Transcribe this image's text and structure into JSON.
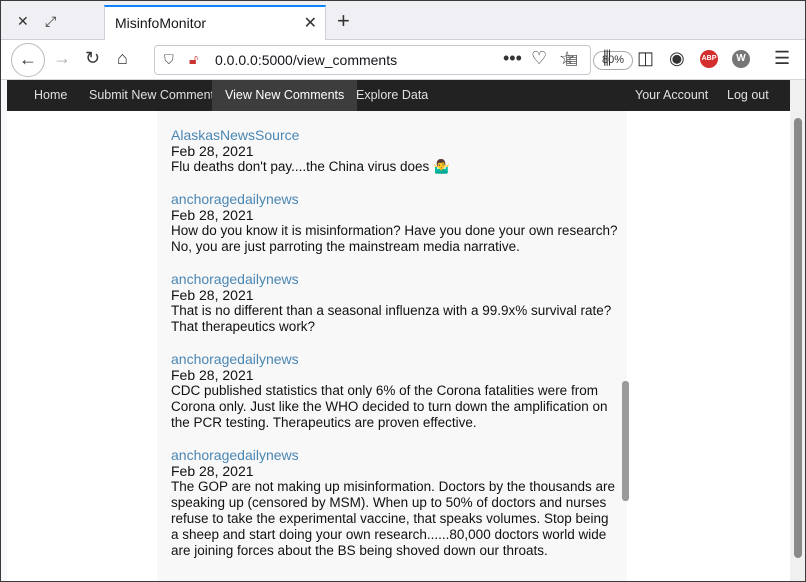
{
  "browser": {
    "tab_title": "MisinfoMonitor",
    "url": "0.0.0.0:5000/view_comments",
    "zoom": "80%",
    "abp_label": "ABP",
    "w_label": "W"
  },
  "nav": {
    "items": [
      "Home",
      "Submit New Comment",
      "View New Comments",
      "Explore Data"
    ],
    "right_items": [
      "Your Account",
      "Log out"
    ],
    "active": "View New Comments"
  },
  "comments": [
    {
      "author": "AlaskasNewsSource",
      "date": "Feb 28, 2021",
      "text": "Flu deaths don't pay....the China virus does 🤷‍♂️"
    },
    {
      "author": "anchoragedailynews",
      "date": "Feb 28, 2021",
      "text": "How do you know it is misinformation? Have you done your own research? No, you are just parroting the mainstream media narrative."
    },
    {
      "author": "anchoragedailynews",
      "date": "Feb 28, 2021",
      "text": "That is no different than a seasonal influenza with a 99.9x% survival rate? That therapeutics work?"
    },
    {
      "author": "anchoragedailynews",
      "date": "Feb 28, 2021",
      "text": "CDC published statistics that only 6% of the Corona fatalities were from Corona only. Just like the WHO decided to turn down the amplification on the PCR testing. Therapeutics are proven effective."
    },
    {
      "author": "anchoragedailynews",
      "date": "Feb 28, 2021",
      "text": "The GOP are not making up misinformation. Doctors by the thousands are speaking up (censored by MSM). When up to 50% of doctors and nurses refuse to take the experimental vaccine, that speaks volumes. Stop being a sheep and start doing your own research......80,000 doctors world wide are joining forces about the BS being shoved down our throats."
    }
  ]
}
